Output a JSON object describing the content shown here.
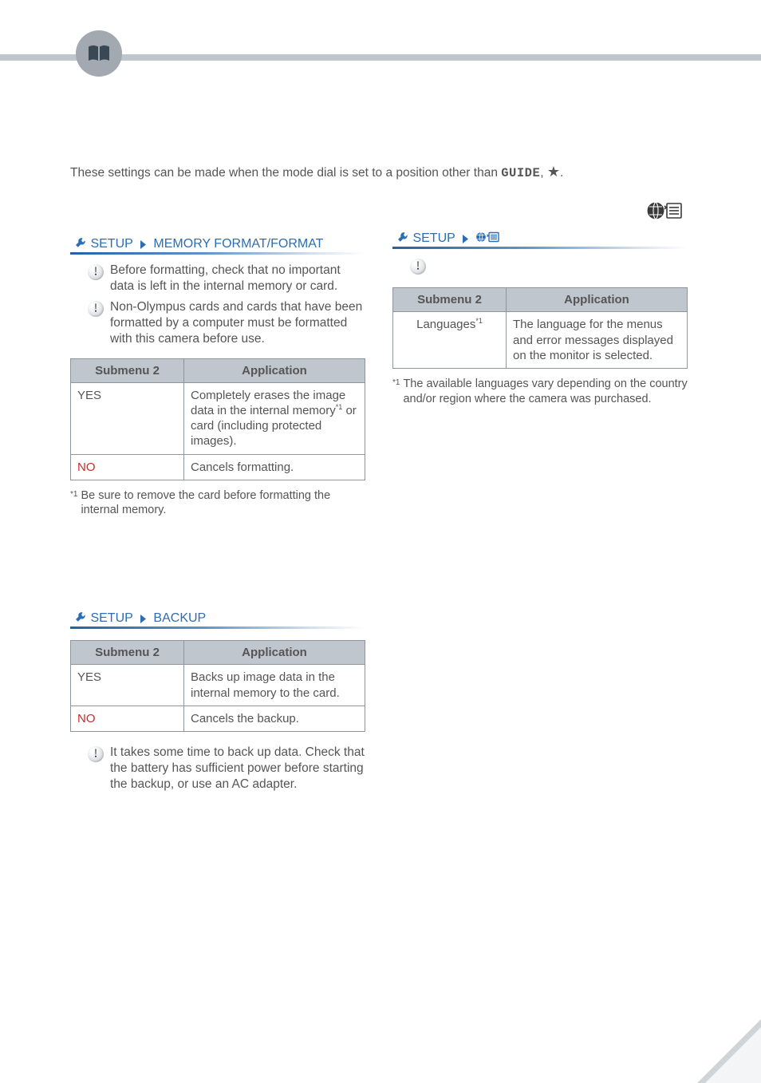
{
  "intro": {
    "text_before": "These settings can be made when the mode dial is set to a position other than ",
    "guide_word": "GUIDE",
    "sep": ", ",
    "star": "★",
    "period": "."
  },
  "sections": {
    "memory_format": {
      "crumb_a": "SETUP",
      "crumb_b": "MEMORY FORMAT/FORMAT",
      "info1": "Before formatting, check that no important data is left in the internal memory or card.",
      "info2": "Non-Olympus cards and cards that have been formatted by a computer must be formatted with this camera before use.",
      "th1": "Submenu 2",
      "th2": "Application",
      "row1_sub": "YES",
      "row1_app_a": "Completely erases the image data in the internal memory",
      "row1_app_sup": "*1",
      "row1_app_b": " or card (including protected images).",
      "row2_sub": "NO",
      "row2_app": "Cancels formatting.",
      "foot_sup": "*1",
      "foot": "Be sure to remove the card before formatting the internal memory."
    },
    "backup": {
      "crumb_a": "SETUP",
      "crumb_b": "BACKUP",
      "th1": "Submenu 2",
      "th2": "Application",
      "row1_sub": "YES",
      "row1_app": "Backs up image data in the internal memory to the card.",
      "row2_sub": "NO",
      "row2_app": "Cancels the backup.",
      "info": "It takes some time to back up data. Check that the battery has sufficient power before starting the backup, or use an AC adapter."
    },
    "language": {
      "crumb_a": "SETUP",
      "info": "",
      "th1": "Submenu 2",
      "th2": "Application",
      "row1_sub": "Languages",
      "row1_sup": "*1",
      "row1_app": "The language for the menus and error messages displayed on the monitor is selected.",
      "foot_sup": "*1",
      "foot": "The available languages vary depending on the country and/or region where the camera was purchased."
    }
  }
}
